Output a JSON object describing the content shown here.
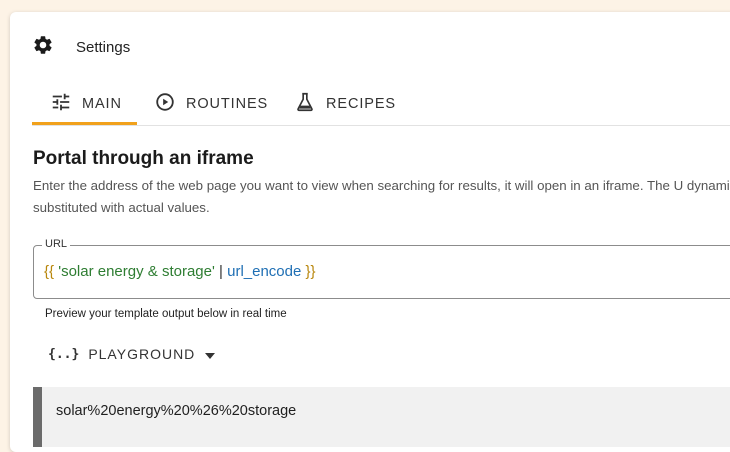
{
  "header": {
    "title": "Settings",
    "icon": "gear-icon"
  },
  "tabs": [
    {
      "label": "MAIN",
      "icon": "tune-icon",
      "active": true
    },
    {
      "label": "ROUTINES",
      "icon": "play-circle-icon",
      "active": false
    },
    {
      "label": "RECIPES",
      "icon": "flask-icon",
      "active": false
    }
  ],
  "colors": {
    "accent": "#f1a11b",
    "string": "#2e7d32",
    "filter": "#1f6fb4",
    "brace": "#b8860b"
  },
  "section": {
    "title": "Portal through an iframe",
    "description": "Enter the address of the web page you want to view when searching for results, it will open in an iframe. The U dynamically substituted with actual values."
  },
  "url_field": {
    "label": "URL",
    "tokens": {
      "open": "{{",
      "string": "'solar energy & storage'",
      "pipe": "|",
      "filter": "url_encode",
      "close": "}}"
    }
  },
  "helper_text": "Preview your template output below in real time",
  "playground": {
    "icon_text": "{..}",
    "label": "PLAYGROUND"
  },
  "preview": {
    "output": "solar%20energy%20%26%20storage"
  }
}
